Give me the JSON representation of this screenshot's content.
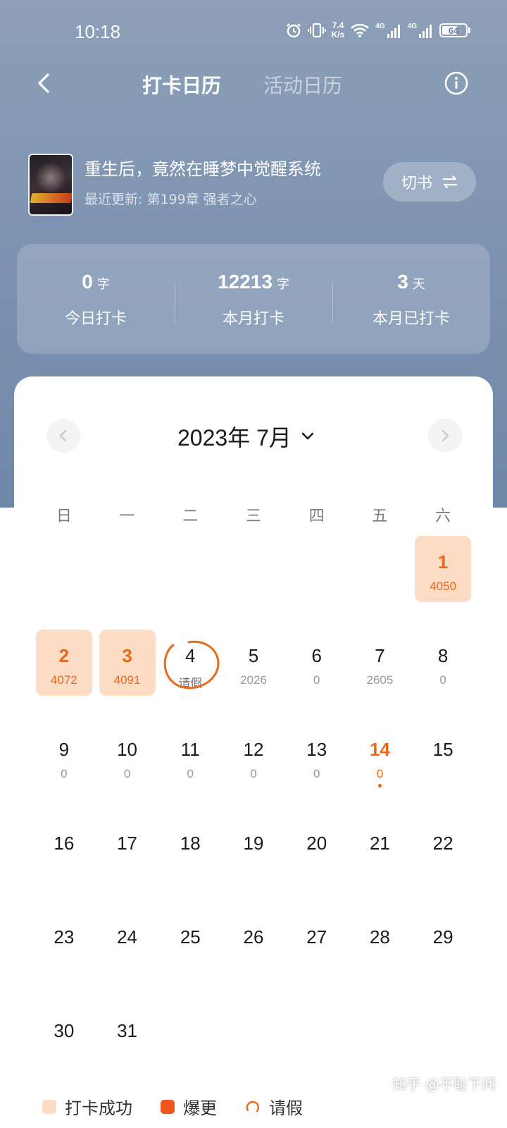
{
  "status_bar": {
    "time": "10:18",
    "net_speed_value": "7.4",
    "net_speed_unit": "K/s",
    "signal1_label": "4G",
    "signal2_label": "4G",
    "battery": "64"
  },
  "nav": {
    "tabs": [
      {
        "label": "打卡日历",
        "active": true
      },
      {
        "label": "活动日历",
        "active": false
      }
    ],
    "back_icon": "chevron-left-icon",
    "info_icon": "info-circle-icon"
  },
  "book": {
    "title": "重生后，竟然在睡梦中觉醒系统",
    "latest_update": "最近更新: 第199章 强者之心",
    "switch_label": "切书",
    "switch_icon": "swap-icon"
  },
  "stats": [
    {
      "value": "0",
      "unit": "字",
      "label": "今日打卡"
    },
    {
      "value": "12213",
      "unit": "字",
      "label": "本月打卡"
    },
    {
      "value": "3",
      "unit": "天",
      "label": "本月已打卡"
    }
  ],
  "calendar": {
    "month_title": "2023年 7月",
    "weekdays": [
      "日",
      "一",
      "二",
      "三",
      "四",
      "五",
      "六"
    ],
    "first_weekday_index": 6,
    "days": [
      {
        "day": "1",
        "value": "4050",
        "status": "success"
      },
      {
        "day": "2",
        "value": "4072",
        "status": "success"
      },
      {
        "day": "3",
        "value": "4091",
        "status": "success"
      },
      {
        "day": "4",
        "value": "请假",
        "status": "leave"
      },
      {
        "day": "5",
        "value": "2026",
        "status": "normal"
      },
      {
        "day": "6",
        "value": "0",
        "status": "normal"
      },
      {
        "day": "7",
        "value": "2605",
        "status": "normal"
      },
      {
        "day": "8",
        "value": "0",
        "status": "normal"
      },
      {
        "day": "9",
        "value": "0",
        "status": "normal"
      },
      {
        "day": "10",
        "value": "0",
        "status": "normal"
      },
      {
        "day": "11",
        "value": "0",
        "status": "normal"
      },
      {
        "day": "12",
        "value": "0",
        "status": "normal"
      },
      {
        "day": "13",
        "value": "0",
        "status": "normal"
      },
      {
        "day": "14",
        "value": "0",
        "status": "today"
      },
      {
        "day": "15",
        "value": "",
        "status": "future"
      },
      {
        "day": "16",
        "value": "",
        "status": "future"
      },
      {
        "day": "17",
        "value": "",
        "status": "future"
      },
      {
        "day": "18",
        "value": "",
        "status": "future"
      },
      {
        "day": "19",
        "value": "",
        "status": "future"
      },
      {
        "day": "20",
        "value": "",
        "status": "future"
      },
      {
        "day": "21",
        "value": "",
        "status": "future"
      },
      {
        "day": "22",
        "value": "",
        "status": "future"
      },
      {
        "day": "23",
        "value": "",
        "status": "future"
      },
      {
        "day": "24",
        "value": "",
        "status": "future"
      },
      {
        "day": "25",
        "value": "",
        "status": "future"
      },
      {
        "day": "26",
        "value": "",
        "status": "future"
      },
      {
        "day": "27",
        "value": "",
        "status": "future"
      },
      {
        "day": "28",
        "value": "",
        "status": "future"
      },
      {
        "day": "29",
        "value": "",
        "status": "future"
      },
      {
        "day": "30",
        "value": "",
        "status": "future"
      },
      {
        "day": "31",
        "value": "",
        "status": "future"
      }
    ]
  },
  "legend": [
    {
      "label": "打卡成功",
      "color": "#fddcc6"
    },
    {
      "label": "爆更",
      "color": "#f0541c"
    },
    {
      "label": "请假",
      "color": "#e86a1c"
    }
  ],
  "watermark": "知乎 @不耻下问",
  "colors": {
    "accent": "#e86a1c",
    "success_bg": "#fddcc6",
    "hero_bg": "#7f95b2"
  }
}
